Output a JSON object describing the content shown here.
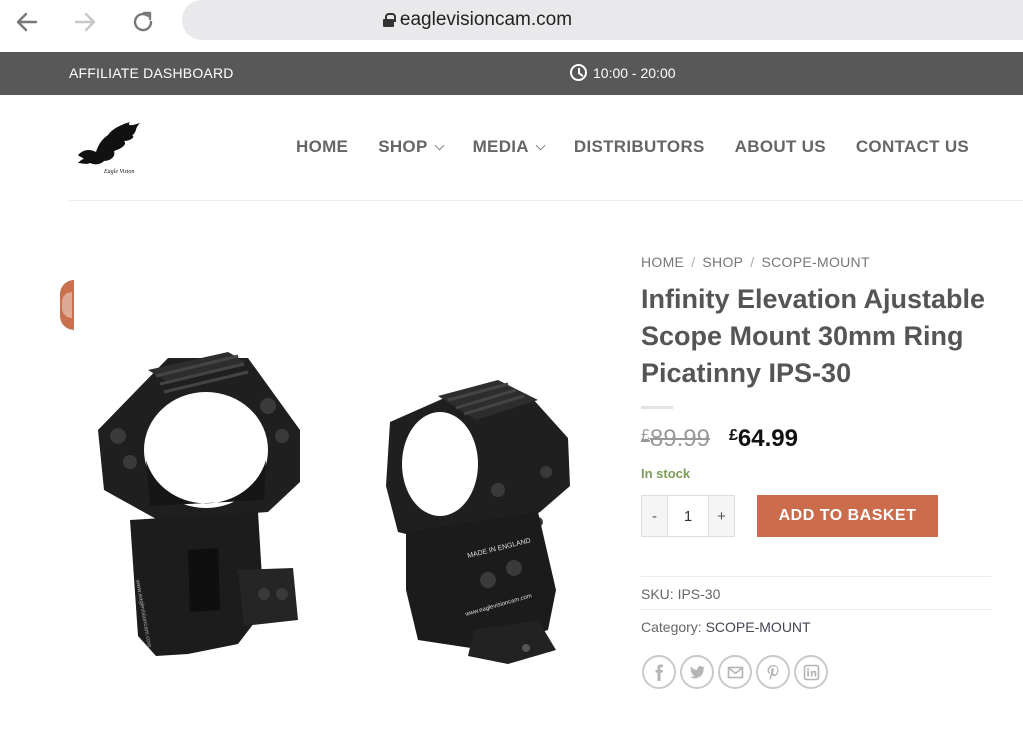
{
  "browser": {
    "url": "eaglevisioncam.com"
  },
  "top_strip": {
    "affiliate_label": "AFFILIATE DASHBOARD",
    "hours": "10:00 - 20:00"
  },
  "nav": {
    "items": [
      {
        "label": "HOME",
        "dropdown": false
      },
      {
        "label": "SHOP",
        "dropdown": true
      },
      {
        "label": "MEDIA",
        "dropdown": true
      },
      {
        "label": "DISTRIBUTORS",
        "dropdown": false
      },
      {
        "label": "ABOUT US",
        "dropdown": false
      },
      {
        "label": "CONTACT US",
        "dropdown": false
      }
    ]
  },
  "breadcrumb": [
    "HOME",
    "SHOP",
    "SCOPE-MOUNT"
  ],
  "product": {
    "title": "Infinity Elevation Ajustable Scope Mount 30mm Ring Picatinny IPS-30",
    "currency": "£",
    "old_price": "89.99",
    "new_price": "64.99",
    "stock": "In stock",
    "quantity": "1",
    "qty_minus": "-",
    "qty_plus": "+",
    "add_button": "ADD TO BASKET",
    "sku_label": "SKU:",
    "sku": "IPS-30",
    "category_label": "Category:",
    "category": "SCOPE-MOUNT",
    "image_text_1": "MADE IN ENGLAND",
    "image_text_2": "www.eaglevisioncam.com"
  },
  "share": [
    "facebook-icon",
    "twitter-icon",
    "email-icon",
    "pinterest-icon",
    "linkedin-icon"
  ],
  "colors": {
    "accent": "#cb6c4c",
    "strip": "#585858",
    "stock": "#7a9c59"
  }
}
